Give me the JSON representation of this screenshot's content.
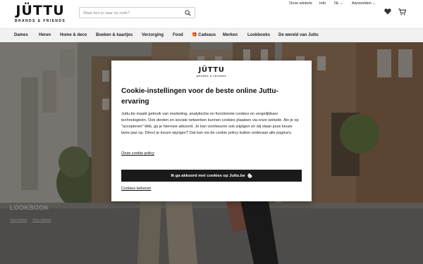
{
  "header": {
    "logo": {
      "main": "JÜTTU",
      "sub": "BRANDS & FRIENDS"
    },
    "search": {
      "placeholder": "Waar ben je naar op zoek?",
      "icon": "search-icon"
    },
    "links": {
      "stores": "Onze winkels",
      "info": "Info",
      "language": "NL",
      "login": "Aanmelden"
    },
    "icons": [
      "heart-icon",
      "cart-icon"
    ]
  },
  "nav": {
    "items": [
      "Dames",
      "Heren",
      "Home & deco",
      "Boeken & kaartjes",
      "Verzorging",
      "Food",
      "🎁 Cadeaus",
      "Merken",
      "Lookbooks",
      "De wereld van Juttu"
    ]
  },
  "hero": {
    "title": "LOOKBOOK",
    "links": [
      "Voor heren",
      "Voor dames"
    ]
  },
  "cookie_modal": {
    "logo": {
      "main": "JÜTTU",
      "sub": "BRANDS & FRIENDS"
    },
    "title": "Cookie-instellingen voor de beste online Juttu-ervaring",
    "body": "Juttu.be maakt gebruik van marketing, analytische en functionele cookies en vergelijkbare technologieën. Ook derden en sociale netwerken kunnen cookies plaatsen via onze website. Als je op \"accepteren\" klikt, ga je hiermee akkoord. Je kan voorkeuren ook wijzigen en wij slaan jouw keuze twee jaar op. Direct je keuze wijzigen? Dat kan via de cookie policy button onderaan alle pagina's.",
    "policy_link": "Onze cookie policy",
    "accept_button": "Ik ga akkoord met cookies op Juttu.be",
    "manage_link": "Cookies beheren"
  },
  "colors": {
    "button": "#1a1a1a",
    "nav_bg": "#f1f1f1",
    "overlay": "rgba(0,0,0,0.45)"
  }
}
